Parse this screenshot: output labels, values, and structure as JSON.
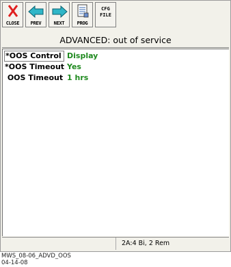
{
  "toolbar": {
    "close": "CLOSE",
    "prev": "PREV",
    "next": "NEXT",
    "prog": "PROG",
    "cfg_line1": "CFG",
    "cfg_line2": "FILE"
  },
  "title": "ADVANCED:  out of service",
  "rows": [
    {
      "label": "*OOS Control",
      "value": "Display"
    },
    {
      "label": "*OOS Timeout",
      "value": "Yes"
    },
    {
      "label": " OOS Timeout",
      "value": "1 hrs"
    }
  ],
  "status_text": "2A:4 Bi, 2 Rem",
  "footer": {
    "line1": "MWS_08-06_ADVD_OOS",
    "line2": "04-14-08"
  },
  "colors": {
    "value": "#1f8a1f",
    "close_icon": "#e02020",
    "arrow": "#2fb6c8"
  }
}
